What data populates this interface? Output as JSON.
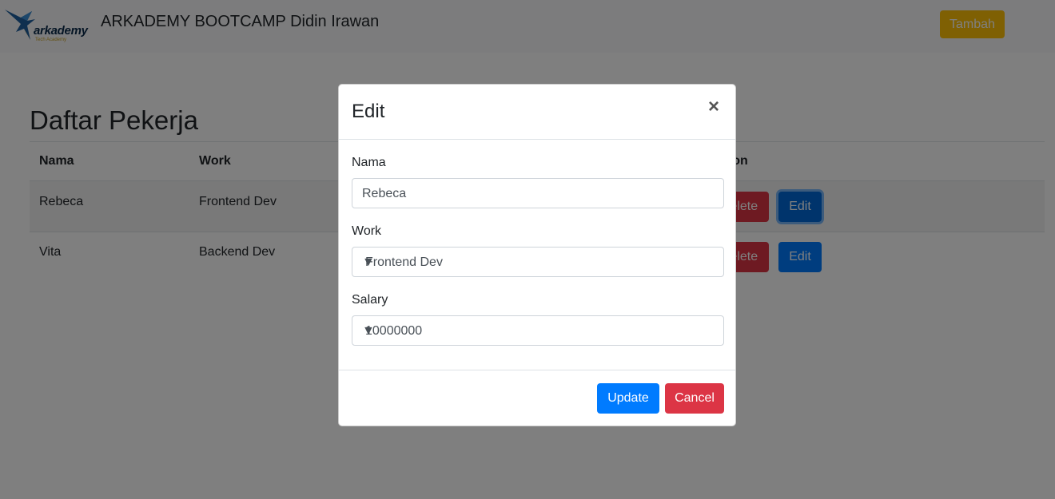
{
  "navbar": {
    "logo_text": "arkademy",
    "logo_subtext": "Tech Academy",
    "title": "ARKADEMY BOOTCAMP Didin Irawan",
    "add_button": "Tambah"
  },
  "page": {
    "heading": "Daftar Pekerja",
    "columns": [
      "Nama",
      "Work",
      "Action"
    ],
    "rows": [
      {
        "nama": "Rebeca",
        "work": "Frontend Dev",
        "delete": "Delete",
        "edit": "Edit"
      },
      {
        "nama": "Vita",
        "work": "Backend Dev",
        "delete": "Delete",
        "edit": "Edit"
      }
    ]
  },
  "modal": {
    "title": "Edit",
    "close": "×",
    "nama_label": "Nama",
    "nama_value": "Rebeca",
    "work_label": "Work",
    "work_value": "Frontend Dev",
    "salary_label": "Salary",
    "salary_value": "10000000",
    "update_button": "Update",
    "cancel_button": "Cancel"
  },
  "colors": {
    "primary": "#007bff",
    "danger": "#dc3545",
    "warning": "#ffc107"
  }
}
